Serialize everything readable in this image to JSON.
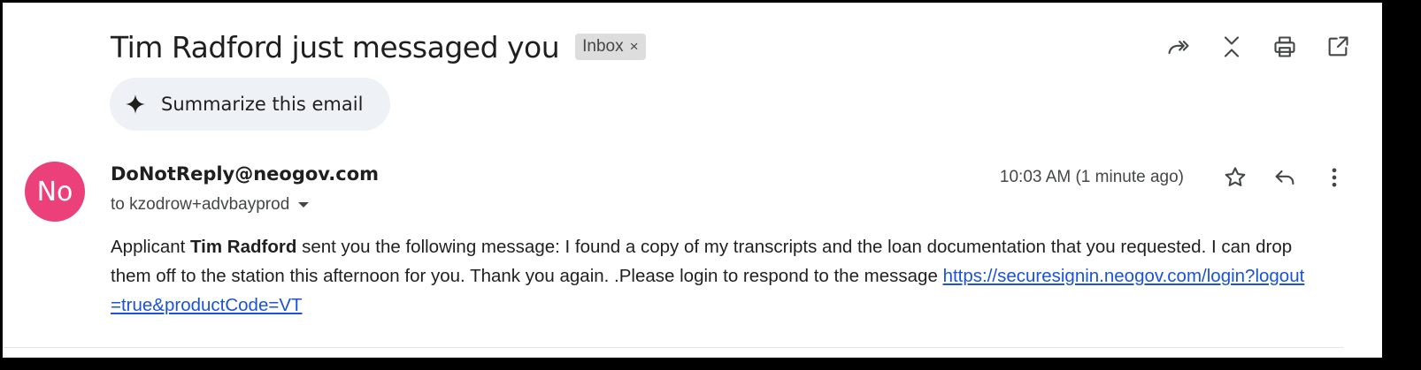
{
  "subject": "Tim Radford just messaged you",
  "label_chip": {
    "text": "Inbox",
    "remove": "×"
  },
  "top_actions": [
    {
      "icon": "forward-all-icon"
    },
    {
      "icon": "collapse-all-icon"
    },
    {
      "icon": "print-icon"
    },
    {
      "icon": "open-in-new-window-icon"
    }
  ],
  "summarize": {
    "label": "Summarize this email",
    "icon": "sparkle-icon"
  },
  "message": {
    "avatar_initials": "No",
    "avatar_color": "#ec407a",
    "sender": "DoNotReply@neogov.com",
    "to": "to kzodrow+advbayprod",
    "timestamp": "10:03 AM (1 minute ago)",
    "body_prefix": "Applicant ",
    "body_bold": "Tim Radford",
    "body_main": " sent you the following message: I found a copy of my transcripts and the loan documentation that you requested. I can drop them off to the station this afternoon for you. Thank you again. .Please login to respond to the message ",
    "body_link": "https://securesignin.neogov.com/login?logout=true&productCode=VT"
  },
  "colors": {
    "link": "#1a53d8",
    "summarize_bg": "#eef1f6",
    "chip_bg": "#dddddd"
  }
}
